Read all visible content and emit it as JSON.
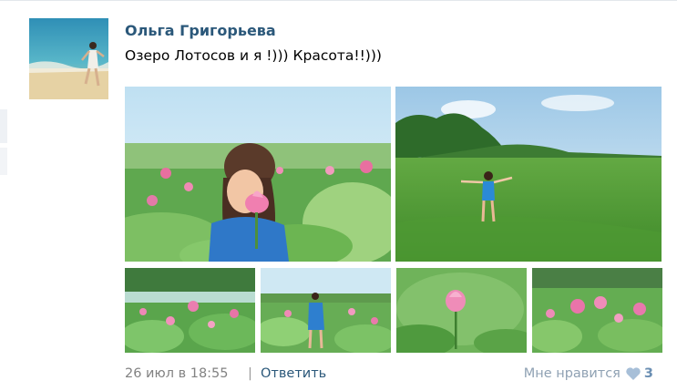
{
  "post": {
    "author": "Ольга Григорьева",
    "text": "Озеро Лотосов и я !))) Красота!!)))",
    "date": "26 июл в 18:55",
    "separator": "|",
    "reply": "Ответить",
    "like_label": "Мне нравится",
    "like_count": "3"
  },
  "icons": {
    "like": "heart-icon"
  },
  "colors": {
    "link": "#2b587a",
    "muted": "#828282",
    "like_heart": "#a7bfd8"
  }
}
